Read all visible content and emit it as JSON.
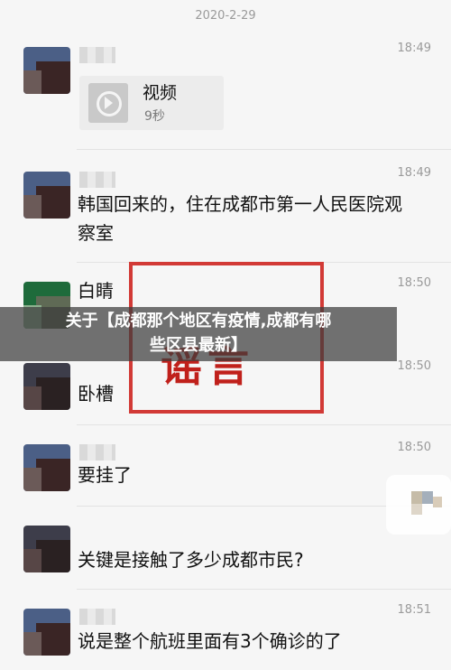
{
  "date": "2020-2-29",
  "messages": [
    {
      "time": "18:49",
      "type": "video",
      "video_title": "视频",
      "video_duration": "9秒"
    },
    {
      "time": "18:49",
      "type": "text",
      "text_line1": "韩国回来的，住在成都市第一人民医院观",
      "text_line2": "察室"
    },
    {
      "time": "18:50",
      "type": "text",
      "text": "白睛"
    },
    {
      "time": "18:50",
      "type": "text",
      "text": "卧槽"
    },
    {
      "time": "18:50",
      "type": "text",
      "text": "要挂了"
    },
    {
      "time": "",
      "type": "text",
      "text": "关键是接触了多少成都市民?"
    },
    {
      "time": "18:51",
      "type": "text",
      "text": "说是整个航班里面有3个确诊的了"
    }
  ],
  "stamp": {
    "text": "谣言",
    "color": "#d23a36"
  },
  "banner": {
    "line1": "关于【成都那个地区有疫情,成都有哪",
    "line2": "些区县最新】"
  },
  "colors": {
    "background": "#f6f6f6",
    "timestamp": "#9a9a9a"
  }
}
